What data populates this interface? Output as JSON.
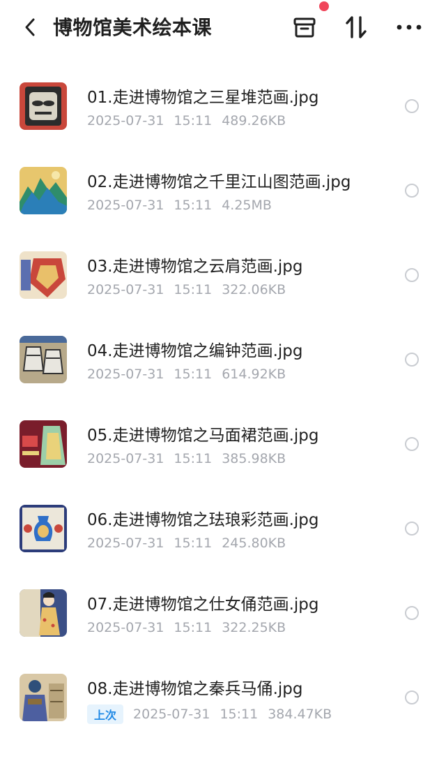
{
  "header": {
    "title": "博物馆美术绘本课",
    "icons": [
      "back-icon",
      "archive-icon",
      "sort-icon",
      "more-icon"
    ],
    "accent": "#f0455a"
  },
  "files": [
    {
      "name": "01.走进博物馆之三星堆范画.jpg",
      "date": "2025-07-31",
      "time": "15:11",
      "size": "489.26KB",
      "badge": ""
    },
    {
      "name": "02.走进博物馆之千里江山图范画.jpg",
      "date": "2025-07-31",
      "time": "15:11",
      "size": "4.25MB",
      "badge": ""
    },
    {
      "name": "03.走进博物馆之云肩范画.jpg",
      "date": "2025-07-31",
      "time": "15:11",
      "size": "322.06KB",
      "badge": ""
    },
    {
      "name": "04.走进博物馆之编钟范画.jpg",
      "date": "2025-07-31",
      "time": "15:11",
      "size": "614.92KB",
      "badge": ""
    },
    {
      "name": "05.走进博物馆之马面裙范画.jpg",
      "date": "2025-07-31",
      "time": "15:11",
      "size": "385.98KB",
      "badge": ""
    },
    {
      "name": "06.走进博物馆之珐琅彩范画.jpg",
      "date": "2025-07-31",
      "time": "15:11",
      "size": "245.80KB",
      "badge": ""
    },
    {
      "name": "07.走进博物馆之仕女俑范画.jpg",
      "date": "2025-07-31",
      "time": "15:11",
      "size": "322.25KB",
      "badge": ""
    },
    {
      "name": "08.走进博物馆之秦兵马俑.jpg",
      "date": "2025-07-31",
      "time": "15:11",
      "size": "384.47KB",
      "badge": "上次"
    }
  ],
  "colors": {
    "meta_text": "#a4a7ae",
    "badge_bg": "#e6f3fd",
    "badge_text": "#1e88e5"
  }
}
